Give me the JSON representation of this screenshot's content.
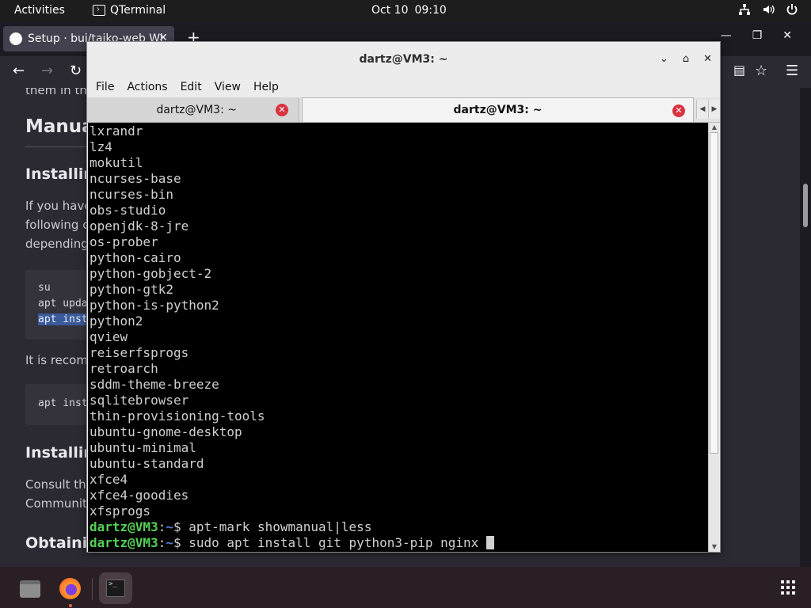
{
  "topbar": {
    "activities": "Activities",
    "app_name": "QTerminal",
    "date": "Oct 10",
    "time": "09:10",
    "tray_icons": [
      "network-icon",
      "volume-icon",
      "power-icon"
    ]
  },
  "browser": {
    "tab_title": "Setup · bui/taiko-web Wi",
    "page": {
      "partial_top": "them in the",
      "h2": "Manua",
      "h3_1": "Installin",
      "p1_l1": "If you have",
      "p1_l2": "following co",
      "p1_l3": "depending",
      "code1": [
        "su",
        "apt upda",
        "apt inst"
      ],
      "p2": "It is recomm",
      "code2": [
        "apt inst"
      ],
      "h3_2": "Installin",
      "p3_l1": "Consult the",
      "p3_l2": "Community",
      "h3_3": "Obtainin"
    }
  },
  "terminal": {
    "window_title": "dartz@VM3: ~",
    "menu": [
      "File",
      "Actions",
      "Edit",
      "View",
      "Help"
    ],
    "tabs": [
      {
        "label": "dartz@VM3: ~",
        "active": false
      },
      {
        "label": "dartz@VM3: ~",
        "active": true
      }
    ],
    "output_lines": [
      "lxrandr",
      "lz4",
      "mokutil",
      "ncurses-base",
      "ncurses-bin",
      "obs-studio",
      "openjdk-8-jre",
      "os-prober",
      "python-cairo",
      "python-gobject-2",
      "python-gtk2",
      "python-is-python2",
      "python2",
      "qview",
      "reiserfsprogs",
      "retroarch",
      "sddm-theme-breeze",
      "sqlitebrowser",
      "thin-provisioning-tools",
      "ubuntu-gnome-desktop",
      "ubuntu-minimal",
      "ubuntu-standard",
      "xfce4",
      "xfce4-goodies",
      "xfsprogs"
    ],
    "prompts": [
      {
        "user_host": "dartz@VM3",
        "sep": ":",
        "path": "~",
        "symbol": "$",
        "command": " apt-mark showmanual|less"
      },
      {
        "user_host": "dartz@VM3",
        "sep": ":",
        "path": "~",
        "symbol": "$",
        "command": " sudo apt install git python3-pip nginx "
      }
    ]
  },
  "dock": {
    "items": [
      "files-icon",
      "firefox-icon",
      "qterminal-icon"
    ],
    "show_apps": "apps-grid-icon"
  },
  "colors": {
    "terminal_bg": "#000000",
    "prompt_user": "#54d054",
    "prompt_path": "#5a7fd8",
    "tab_close": "#d9333f"
  }
}
